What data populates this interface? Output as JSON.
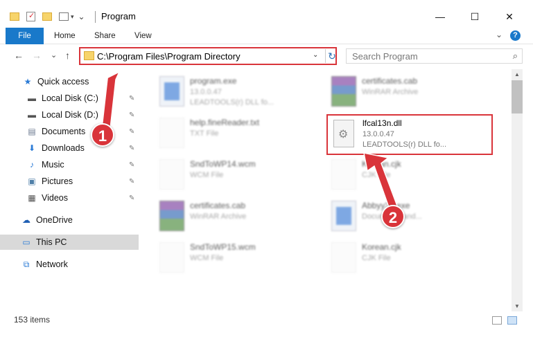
{
  "window": {
    "title": "Program",
    "minimize": "—",
    "maximize": "☐",
    "close": "✕"
  },
  "ribbon": {
    "tabs": [
      "File",
      "Home",
      "Share",
      "View"
    ],
    "expand": "⌄",
    "help": "?"
  },
  "nav": {
    "back": "←",
    "forward": "→",
    "history": "⌄",
    "up": "↑",
    "address": "C:\\Program Files\\Program Directory",
    "dropdown": "⌄",
    "refresh": "↻",
    "search_placeholder": "Search Program"
  },
  "sidebar": {
    "items": [
      {
        "label": "Quick access",
        "icon": "star-icon",
        "glyph": "★",
        "color": "#2b7bd6"
      },
      {
        "label": "Local Disk (C:)",
        "icon": "drive-icon",
        "glyph": "▬",
        "color": "#555"
      },
      {
        "label": "Local Disk (D:)",
        "icon": "drive-icon",
        "glyph": "▬",
        "color": "#555"
      },
      {
        "label": "Documents",
        "icon": "documents-icon",
        "glyph": "▤",
        "color": "#6b7a90"
      },
      {
        "label": "Downloads",
        "icon": "downloads-icon",
        "glyph": "⬇",
        "color": "#2b7bd6"
      },
      {
        "label": "Music",
        "icon": "music-icon",
        "glyph": "♪",
        "color": "#2b7bd6"
      },
      {
        "label": "Pictures",
        "icon": "pictures-icon",
        "glyph": "▣",
        "color": "#4f7fa8"
      },
      {
        "label": "Videos",
        "icon": "videos-icon",
        "glyph": "▦",
        "color": "#555"
      },
      {
        "label": "OneDrive",
        "icon": "onedrive-icon",
        "glyph": "☁",
        "color": "#1f5fb3"
      },
      {
        "label": "This PC",
        "icon": "this-pc-icon",
        "glyph": "▭",
        "color": "#2b7bd6"
      },
      {
        "label": "Network",
        "icon": "network-icon",
        "glyph": "⧉",
        "color": "#2b7bd6"
      }
    ],
    "pin": "📌"
  },
  "files": [
    {
      "name": "program.exe",
      "line2": "13.0.0.47",
      "line3": "LEADTOOLS(r) DLL fo...",
      "icon": "exe"
    },
    {
      "name": "certificates.cab",
      "line2": "WinRAR Archive",
      "line3": "",
      "icon": "rar"
    },
    {
      "name": "help.fineReader.txt",
      "line2": "TXT File",
      "line3": "",
      "icon": "doc"
    },
    {
      "name": "lfcal13n.dll",
      "line2": "13.0.0.47",
      "line3": "LEADTOOLS(r) DLL fo...",
      "icon": "dll"
    },
    {
      "name": "SndToWP14.wcm",
      "line2": "WCM File",
      "line3": "",
      "icon": "doc"
    },
    {
      "name": "Korean.cjk",
      "line2": "CJK File",
      "line3": "",
      "icon": "doc"
    },
    {
      "name": "certificates.cab",
      "line2": "WinRAR Archive",
      "line3": "",
      "icon": "rar"
    },
    {
      "name": "Abbyy32.exe",
      "line2": "Document hand...",
      "line3": "",
      "icon": "exe"
    },
    {
      "name": "SndToWP15.wcm",
      "line2": "WCM File",
      "line3": "",
      "icon": "doc"
    },
    {
      "name": "Korean.cjk",
      "line2": "CJK File",
      "line3": "",
      "icon": "doc"
    }
  ],
  "status": {
    "items": "153 items"
  },
  "annotations": {
    "badge1": "1",
    "badge2": "2",
    "color": "#d9343a"
  }
}
